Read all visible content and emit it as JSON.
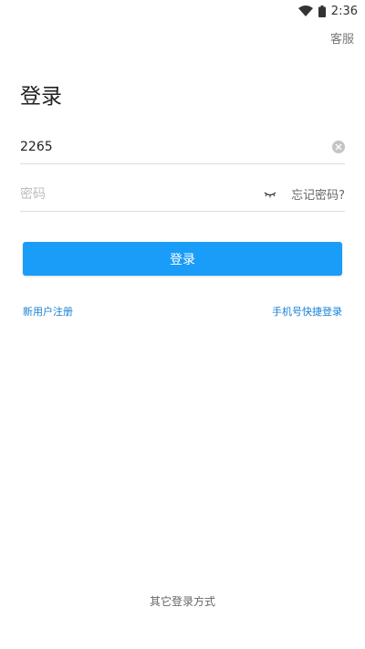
{
  "status_bar": {
    "time": "2:36",
    "wifi_icon": "wifi-icon",
    "battery_icon": "battery-icon"
  },
  "header": {
    "service_label": "客服"
  },
  "page": {
    "title": "登录"
  },
  "form": {
    "account_value": "2265",
    "account_placeholder": "",
    "password_placeholder": "密码",
    "password_value": "",
    "forgot_label": "忘记密码?",
    "clear_icon": "clear-icon",
    "eye_icon": "eye-closed-icon",
    "login_label": "登录"
  },
  "links": {
    "register_label": "新用户注册",
    "phone_login_label": "手机号快捷登录"
  },
  "footer": {
    "other_login_label": "其它登录方式"
  },
  "colors": {
    "primary": "#1a9cf9",
    "link": "#1782d6",
    "text_muted": "#777777",
    "divider": "#dcdcdc"
  }
}
